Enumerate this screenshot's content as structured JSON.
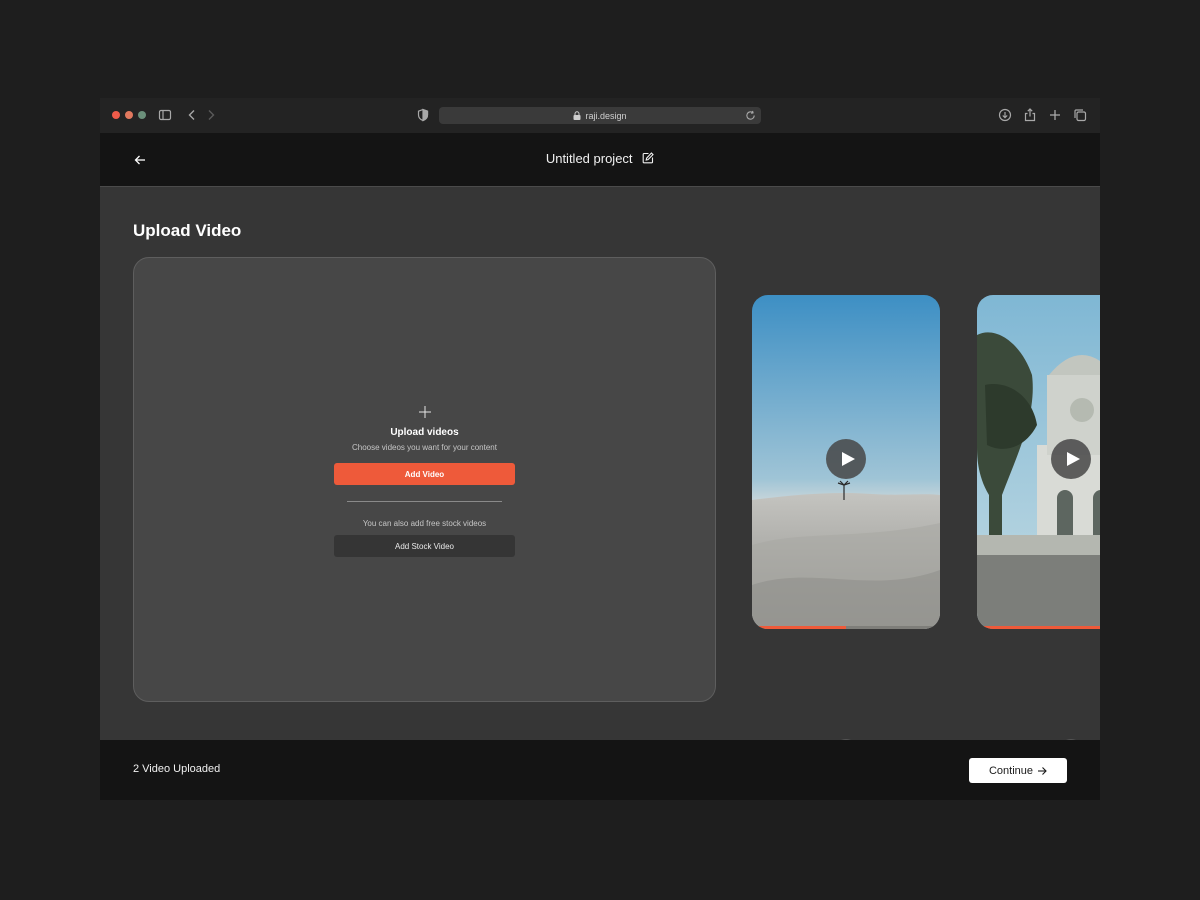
{
  "browser": {
    "url": "raji.design",
    "icons": [
      "sidebar-icon",
      "chevron-left-icon",
      "chevron-right-icon",
      "shield-icon",
      "lock-icon",
      "reload-icon",
      "download-icon",
      "share-icon",
      "plus-icon",
      "tabs-icon"
    ]
  },
  "header": {
    "project_title": "Untitled project"
  },
  "main": {
    "title": "Upload Video",
    "dropzone": {
      "title": "Upload videos",
      "subtitle": "Choose videos you want for your content",
      "add_button": "Add Video",
      "stock_text": "You can also add free stock videos",
      "stock_button": "Add Stock Video"
    },
    "videos": [
      {
        "thumbnail": "desert-palm",
        "progress": 0.5
      },
      {
        "thumbnail": "ornate-building",
        "progress": 0.7
      }
    ]
  },
  "footer": {
    "status": "2 Video Uploaded",
    "continue_label": "Continue"
  },
  "colors": {
    "accent": "#ee5a3a",
    "background": "#363636",
    "header": "#141414"
  }
}
